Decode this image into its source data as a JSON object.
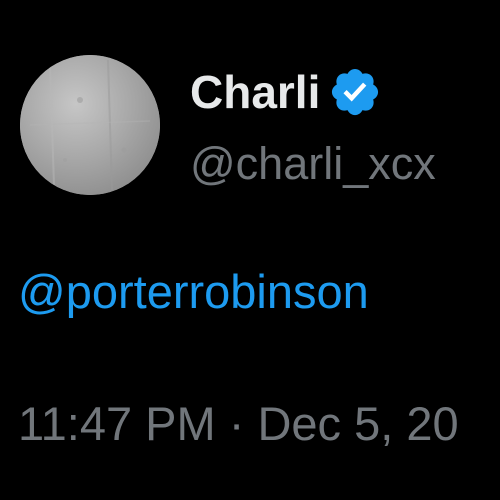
{
  "tweet": {
    "author": {
      "display_name": "Charli",
      "handle": "@charli_xcx",
      "verified": true,
      "verified_icon": "verified-badge-icon",
      "avatar_icon": "profile-avatar"
    },
    "body": {
      "mention": "@porterrobinson"
    },
    "timestamp": "11:47 PM · Dec 5, 20"
  },
  "colors": {
    "background": "#000000",
    "display_name": "#e7e9ea",
    "secondary_text": "#71767b",
    "link": "#1d9bf0",
    "verified_badge": "#1d9bf0"
  }
}
